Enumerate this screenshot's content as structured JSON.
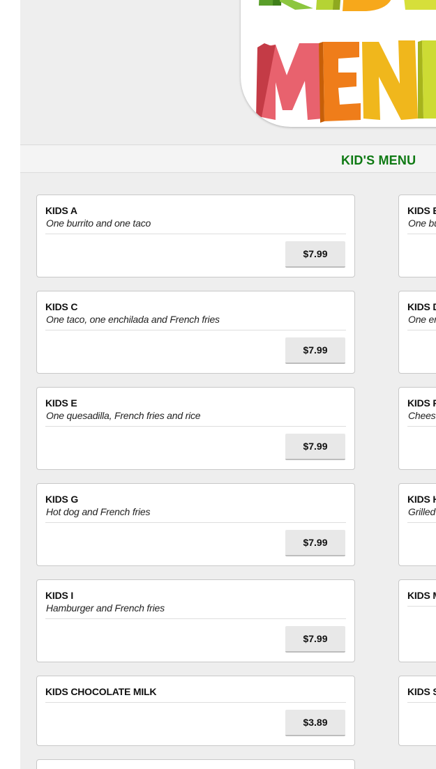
{
  "hero": {
    "logo_alt": "KIDS MENU",
    "logo_line1": "KIDS",
    "logo_line2": "MENU"
  },
  "category": {
    "title": "KID'S MENU",
    "accent": "#0f7a14"
  },
  "items_left": [
    {
      "name": "KIDS A",
      "desc": "One burrito and one taco",
      "price": "$7.99"
    },
    {
      "name": "KIDS C",
      "desc": "One taco, one enchilada and French fries",
      "price": "$7.99"
    },
    {
      "name": "KIDS E",
      "desc": "One quesadilla, French fries and rice",
      "price": "$7.99"
    },
    {
      "name": "KIDS G",
      "desc": "Hot dog and French fries",
      "price": "$7.99"
    },
    {
      "name": "KIDS I",
      "desc": "Hamburger and French fries",
      "price": "$7.99"
    },
    {
      "name": "KIDS CHOCOLATE MILK",
      "desc": "",
      "price": "$3.89"
    }
  ],
  "items_right": [
    {
      "name": "KIDS B",
      "desc": "One bu"
    },
    {
      "name": "KIDS D",
      "desc": "One en"
    },
    {
      "name": "KIDS F",
      "desc": "Chees"
    },
    {
      "name": "KIDS H",
      "desc": "Grilled"
    },
    {
      "name": "KIDS M",
      "desc": ""
    },
    {
      "name": "KIDS S",
      "desc": ""
    }
  ]
}
